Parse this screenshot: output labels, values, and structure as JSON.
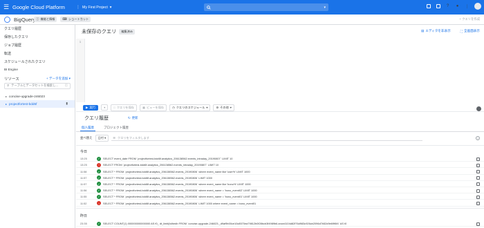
{
  "topbar": {
    "app_title": "Google Cloud Platform",
    "project_name": "My First Project",
    "search_placeholder": ""
  },
  "subbar": {
    "product_title": "BigQuery",
    "feature_chip": "機能と情報",
    "shortcut_chip": "ショートカット",
    "new_query_button": "クエリを作成"
  },
  "sidebar": {
    "items": [
      {
        "label": "クエリ履歴"
      },
      {
        "label": "保存したクエリ"
      },
      {
        "label": "ジョブ履歴"
      },
      {
        "label": "転送"
      },
      {
        "label": "スケジュールされたクエリ"
      },
      {
        "label": "BI Engine"
      }
    ],
    "resources_label": "リソース",
    "add_data_label": "データを追加",
    "filter_placeholder": "テーブルとデータセットを検索し...",
    "tree": [
      {
        "label": "concise-upgrade-246023",
        "selected": false
      },
      {
        "label": "projectfortest-bdd6f",
        "selected": true
      }
    ]
  },
  "editor": {
    "title": "未保存のクエリ",
    "badge": "編集済み",
    "hide_editor": "エディタを非表示",
    "fullscreen": "全画面表示",
    "line_number": "1"
  },
  "toolbar": {
    "run": "実行",
    "save_query": "クエリを保存",
    "save_view": "ビューを保存",
    "schedule": "クエリのスケジュール",
    "more": "その他"
  },
  "history": {
    "title": "クエリ履歴",
    "refresh": "更新",
    "tabs": [
      "個人履歴",
      "プロジェクト履歴"
    ],
    "sort_label": "並べ替え",
    "sort_value": "日付",
    "filter_placeholder": "クエリをフィルタします",
    "today_label": "今日",
    "yesterday_label": "昨日",
    "today_rows": [
      {
        "time": "13:25",
        "status": "ok",
        "query": "SELECT event_date FROM `projectfortest-bdd6f.analytics_206138562.events_intraday_20190807` LIMIT 10"
      },
      {
        "time": "13:25",
        "status": "err",
        "query": "SELECT FROM `projectfortest-bdd6f.analytics_206138562.events_intraday_20190807` LIMIT 10"
      },
      {
        "time": "11:58",
        "status": "ok",
        "query": "SELECT * FROM `projectfortest-bdd6f.analytics_206138562.events_20190806` where event_name like 'user%' LIMIT 1000"
      },
      {
        "time": "11:57",
        "status": "ok",
        "query": "SELECT * FROM `projectfortest-bdd6f.analytics_206138562.events_20190806` LIMIT 1000"
      },
      {
        "time": "11:57",
        "status": "ok",
        "query": "SELECT * FROM `projectfortest-bdd6f.analytics_206138562.events_20190806` where event_name like 'bono%' LIMIT 1000"
      },
      {
        "time": "11:56",
        "status": "ok",
        "query": "SELECT * FROM `projectfortest-bdd6f.analytics_206138562.events_20190806` where event_name = 'bono_event02' LIMIT 1000"
      },
      {
        "time": "11:55",
        "status": "ok",
        "query": "SELECT * FROM `projectfortest-bdd6f.analytics_206138562.events_20190806` where event_name = 'bono_event01' LIMIT 1000"
      },
      {
        "time": "11:52",
        "status": "err",
        "query": "SELECT * FROM `projectfortest-bdd6f.analytics_206138562.events_20190806` LIMIT 1000 where event_name = bono_event01"
      }
    ],
    "yesterday_rows": [
      {
        "time": "23:35",
        "status": "ok",
        "query": "SELECT COUNT(1) 000000000000000 AS f0_ dt_limit(bdhedb FROM `concise-upgrade-246023._d9af9b00ce10c8570ea79812b0f28bcb3f4989b6.anon4104d82f76d983c926cb2096d7b52d9e69f6f4` AS t0"
      }
    ]
  },
  "colors": {
    "brand_blue": "#1a73e8",
    "success_green": "#1e8e3e",
    "error_red": "#d93025"
  }
}
